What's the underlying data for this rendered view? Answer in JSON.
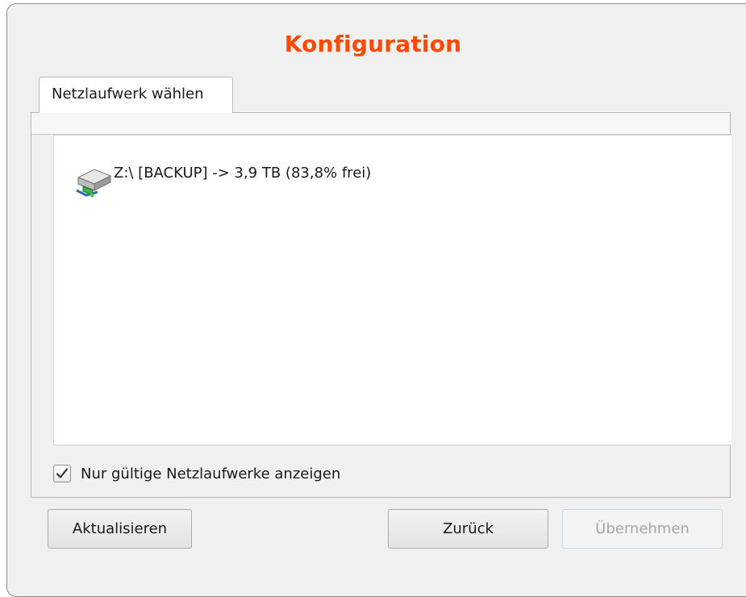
{
  "dialog": {
    "title": "Konfiguration",
    "title_color": "#ff4a00"
  },
  "tab": {
    "label": "Netzlaufwerk wählen"
  },
  "drive_list": {
    "items": [
      {
        "icon": "network-drive-icon",
        "label": "Z:\\ [BACKUP] -> 3,9 TB (83,8% frei)"
      }
    ]
  },
  "filter": {
    "checked": true,
    "label": "Nur gültige Netzlaufwerke anzeigen"
  },
  "buttons": {
    "refresh": "Aktualisieren",
    "back": "Zurück",
    "apply": "Übernehmen",
    "apply_enabled": false
  }
}
